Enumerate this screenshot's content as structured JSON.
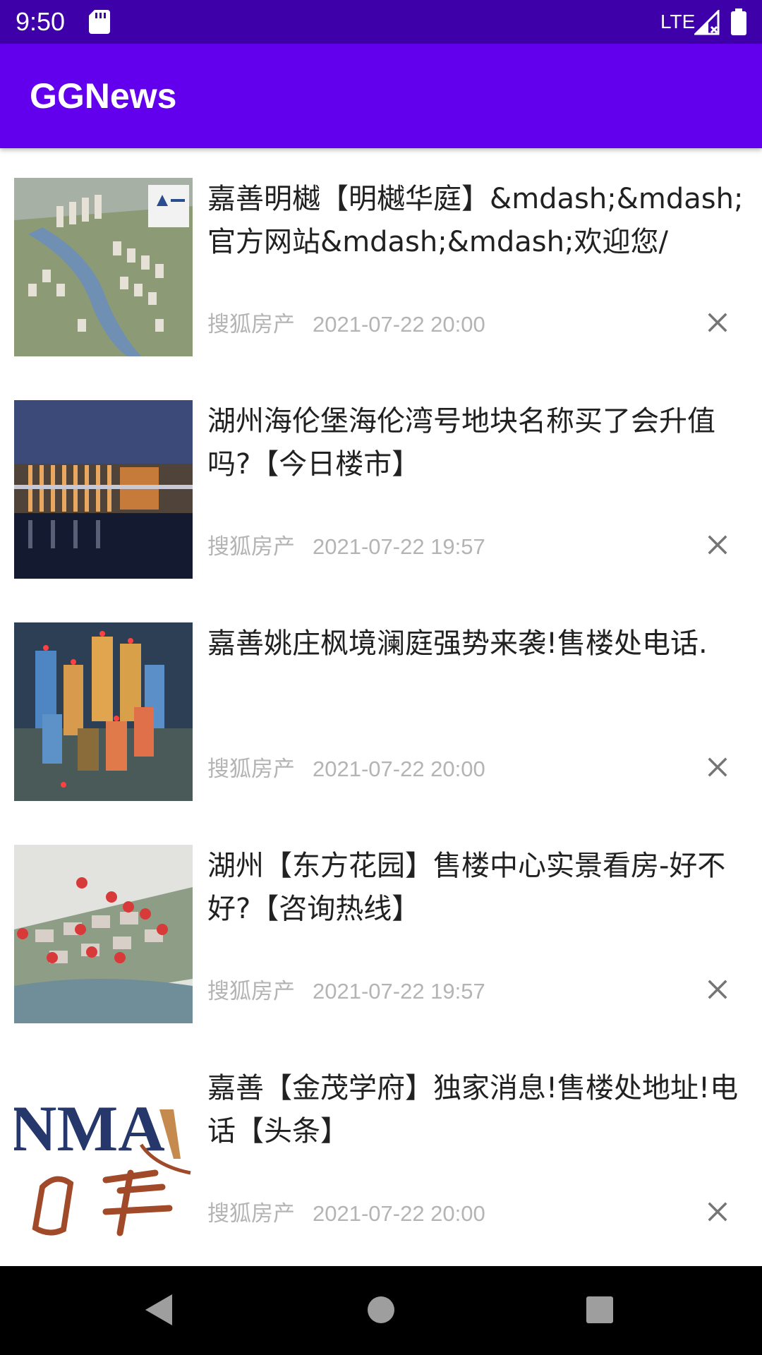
{
  "status_bar": {
    "time": "9:50",
    "network": "LTE",
    "icons": [
      "sd-card-icon",
      "signal-icon",
      "battery-icon"
    ]
  },
  "app_bar": {
    "title": "GGNews",
    "color": "#6200ee"
  },
  "news": [
    {
      "title": "嘉善明樾【明樾华庭】&mdash;&mdash;官方网站&mdash;&mdash;欢迎您/",
      "source": "搜狐房产",
      "time": "2021-07-22 20:00",
      "thumb": "aerial-riverside-complex"
    },
    {
      "title": "湖州海伦堡海伦湾号地块名称买了会升值吗?【今日楼市】",
      "source": "搜狐房产",
      "time": "2021-07-22 19:57",
      "thumb": "night-building-facade"
    },
    {
      "title": "嘉善姚庄枫境澜庭强势来袭!售楼处电话.",
      "source": "搜狐房产",
      "time": "2021-07-22 20:00",
      "thumb": "high-rise-towers-rendering"
    },
    {
      "title": "湖州【东方花园】售楼中心实景看房-好不好?【咨询热线】",
      "source": "搜狐房产",
      "time": "2021-07-22 19:57",
      "thumb": "villa-site-plan"
    },
    {
      "title": "嘉善【金茂学府】独家消息!售楼处地址!电话【头条】",
      "source": "搜狐房产",
      "time": "2021-07-22 20:00",
      "thumb": "logo-nmh-guojin"
    }
  ],
  "nav_bar": {
    "buttons": [
      "back-icon",
      "home-icon",
      "recents-icon"
    ]
  }
}
